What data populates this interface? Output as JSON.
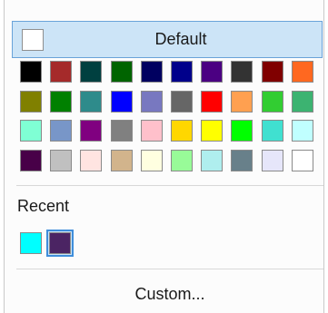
{
  "default_button": {
    "label": "Default",
    "swatch_color": "#ffffff"
  },
  "palette": [
    [
      "#000000",
      "#a52a2a",
      "#004040",
      "#006400",
      "#000060",
      "#00008b",
      "#4b0082",
      "#333333",
      "#800000",
      "#ff6820"
    ],
    [
      "#808000",
      "#008000",
      "#2e8b8b",
      "#0000ff",
      "#7878c0",
      "#666666",
      "#ff0000",
      "#ffa050",
      "#32cd32",
      "#3cb371"
    ],
    [
      "#7fffd4",
      "#7896c8",
      "#800080",
      "#808080",
      "#ffc0cb",
      "#ffd700",
      "#ffff00",
      "#00ff00",
      "#40e0d0",
      "#c0ffff"
    ],
    [
      "#480048",
      "#c0c0c0",
      "#ffe4e1",
      "#d2b48c",
      "#ffffe0",
      "#98fb98",
      "#afeeee",
      "#68808a",
      "#e6e6fa",
      "#ffffff"
    ]
  ],
  "recent_label": "Recent",
  "recent_colors": [
    "#00ffff",
    "#4b2463"
  ],
  "selected_recent_index": 1,
  "custom_button": {
    "label": "Custom..."
  }
}
